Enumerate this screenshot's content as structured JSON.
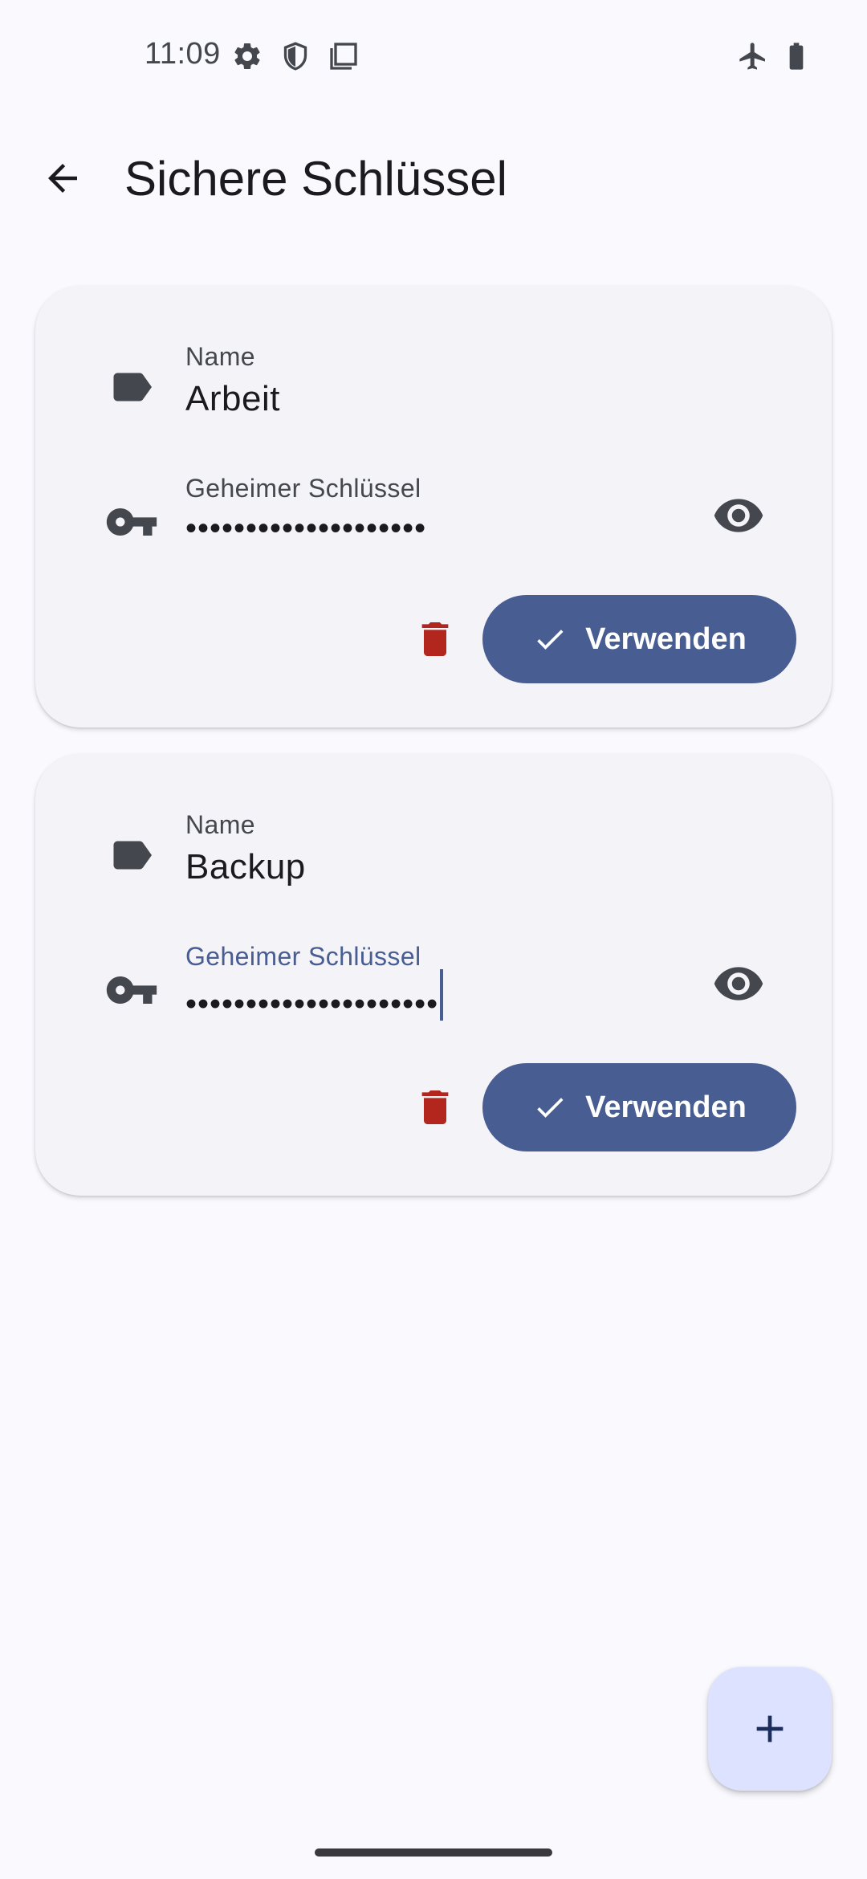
{
  "status_bar": {
    "time": "11:09",
    "icons": [
      "settings-icon",
      "shield-icon",
      "screenshot-icon",
      "airplane-mode-icon",
      "battery-icon"
    ]
  },
  "top_bar": {
    "title": "Sichere Schlüssel",
    "back_icon": "arrow-back-icon"
  },
  "keys": [
    {
      "name_label": "Name",
      "name_value": "Arbeit",
      "secret_label": "Geheimer Schlüssel",
      "secret_masked": "••••••••••••••••••••",
      "focused": false,
      "use_label": "Verwenden"
    },
    {
      "name_label": "Name",
      "name_value": "Backup",
      "secret_label": "Geheimer Schlüssel",
      "secret_masked": "•••••••••••••••••••••",
      "focused": true,
      "use_label": "Verwenden"
    }
  ],
  "fab": {
    "icon": "add-icon"
  },
  "colors": {
    "background": "#f9f9fe",
    "card": "#f3f3f8",
    "primary": "#485d92",
    "delete": "#b3261e",
    "fab": "#dce2ff",
    "icon": "#44474e"
  }
}
